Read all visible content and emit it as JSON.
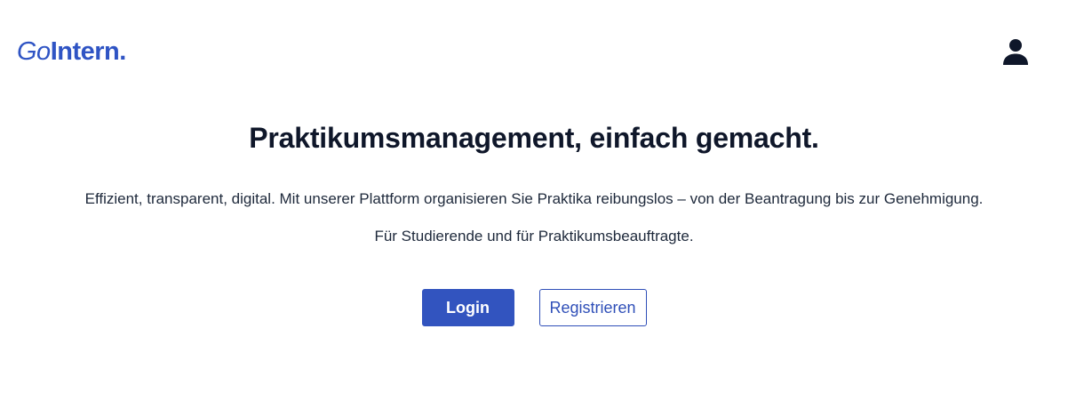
{
  "header": {
    "logo_prefix": "Go",
    "logo_main": "Intern.",
    "user_icon": "user-icon"
  },
  "hero": {
    "title": "Praktikumsmanagement, einfach gemacht.",
    "lead": "Effizient, transparent, digital. Mit unserer Plattform organisieren Sie Praktika reibungslos – von der Beantragung bis zur Genehmigung.",
    "sub": "Für Studierende und für Praktikumsbeauftragte."
  },
  "actions": {
    "login_label": "Login",
    "register_label": "Registrieren"
  },
  "colors": {
    "brand": "#2f54c4",
    "primary_button": "#3254bf",
    "text_dark": "#0f172a"
  }
}
